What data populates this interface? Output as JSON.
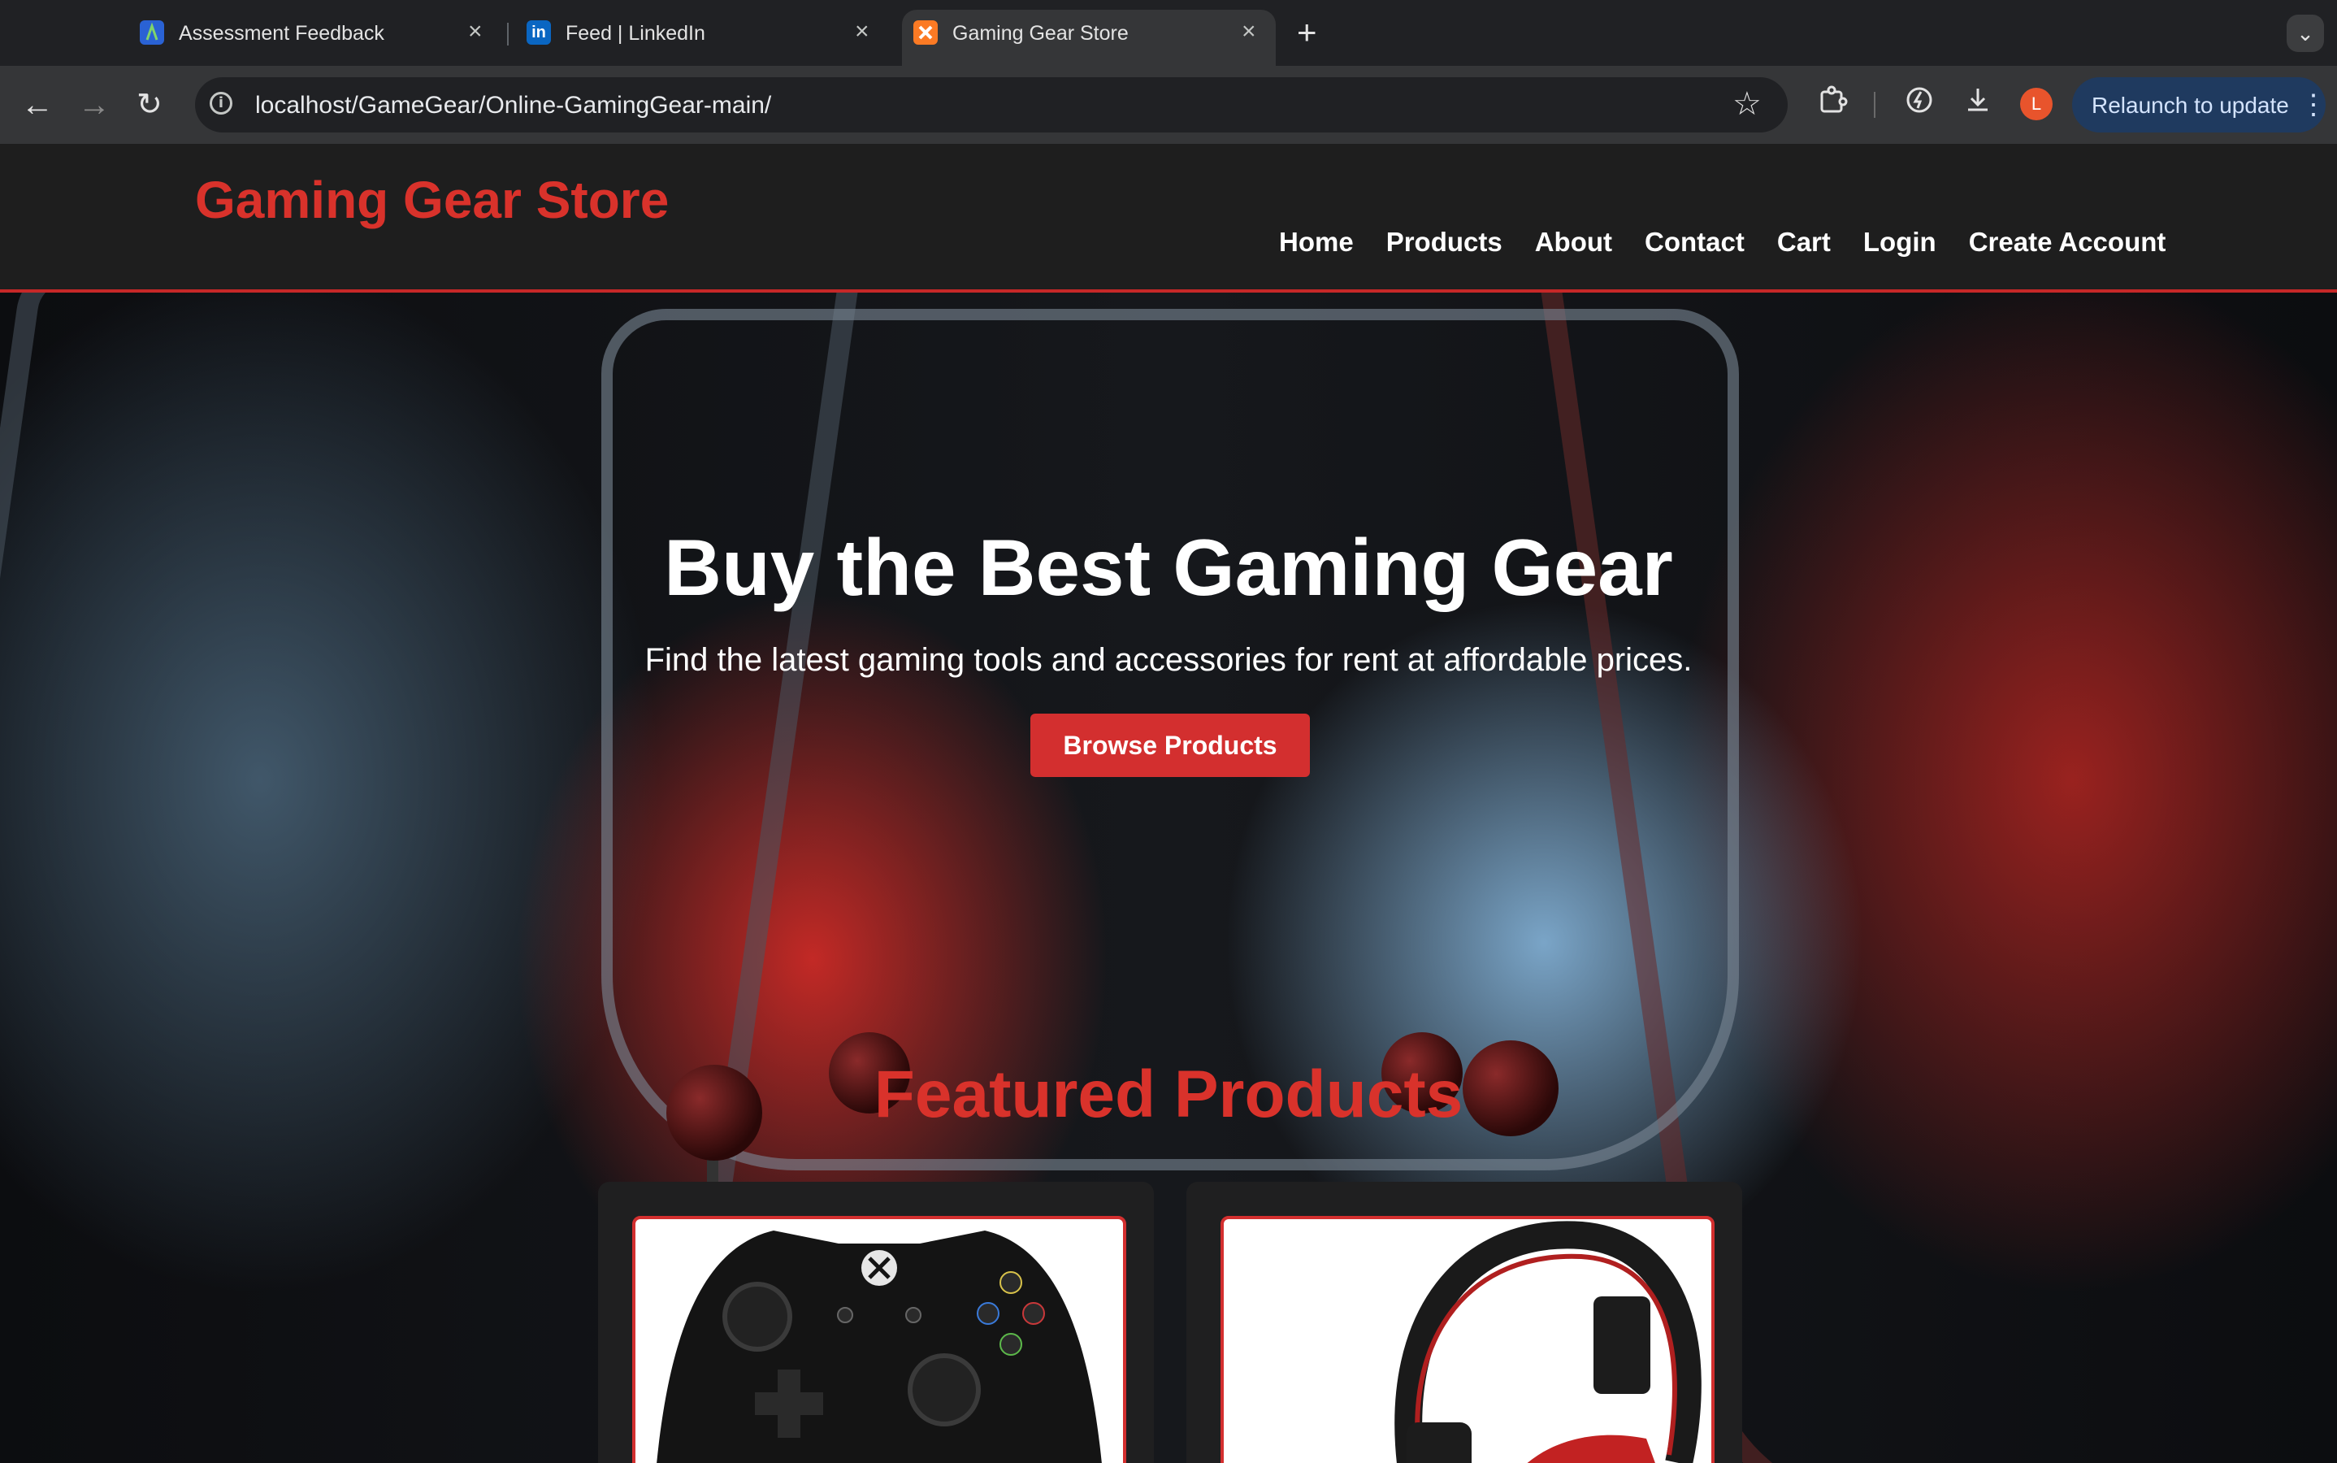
{
  "browser": {
    "tabs": [
      {
        "title": "Assessment Feedback",
        "favicon": "assessment-favicon"
      },
      {
        "title": "Feed | LinkedIn",
        "favicon": "linkedin-favicon"
      },
      {
        "title": "Gaming Gear Store",
        "favicon": "xampp-favicon",
        "active": true
      }
    ],
    "url": "localhost/GameGear/Online-GamingGear-main/",
    "profile_initial": "L",
    "relaunch_label": "Relaunch to update"
  },
  "site": {
    "logo": "Gaming Gear Store",
    "nav": [
      "Home",
      "Products",
      "About",
      "Contact",
      "Cart",
      "Login",
      "Create Account"
    ]
  },
  "hero": {
    "title": "Buy the Best Gaming Gear",
    "subtitle": "Find the latest gaming tools and accessories for rent at affordable prices.",
    "cta": "Browse Products"
  },
  "featured": {
    "heading": "Featured Products",
    "products": [
      {
        "image": "xbox-controller"
      },
      {
        "image": "gaming-headset"
      }
    ]
  },
  "colors": {
    "accent": "#d32f2f",
    "logo": "#d9322b",
    "header_bg": "#1e1e1e"
  }
}
